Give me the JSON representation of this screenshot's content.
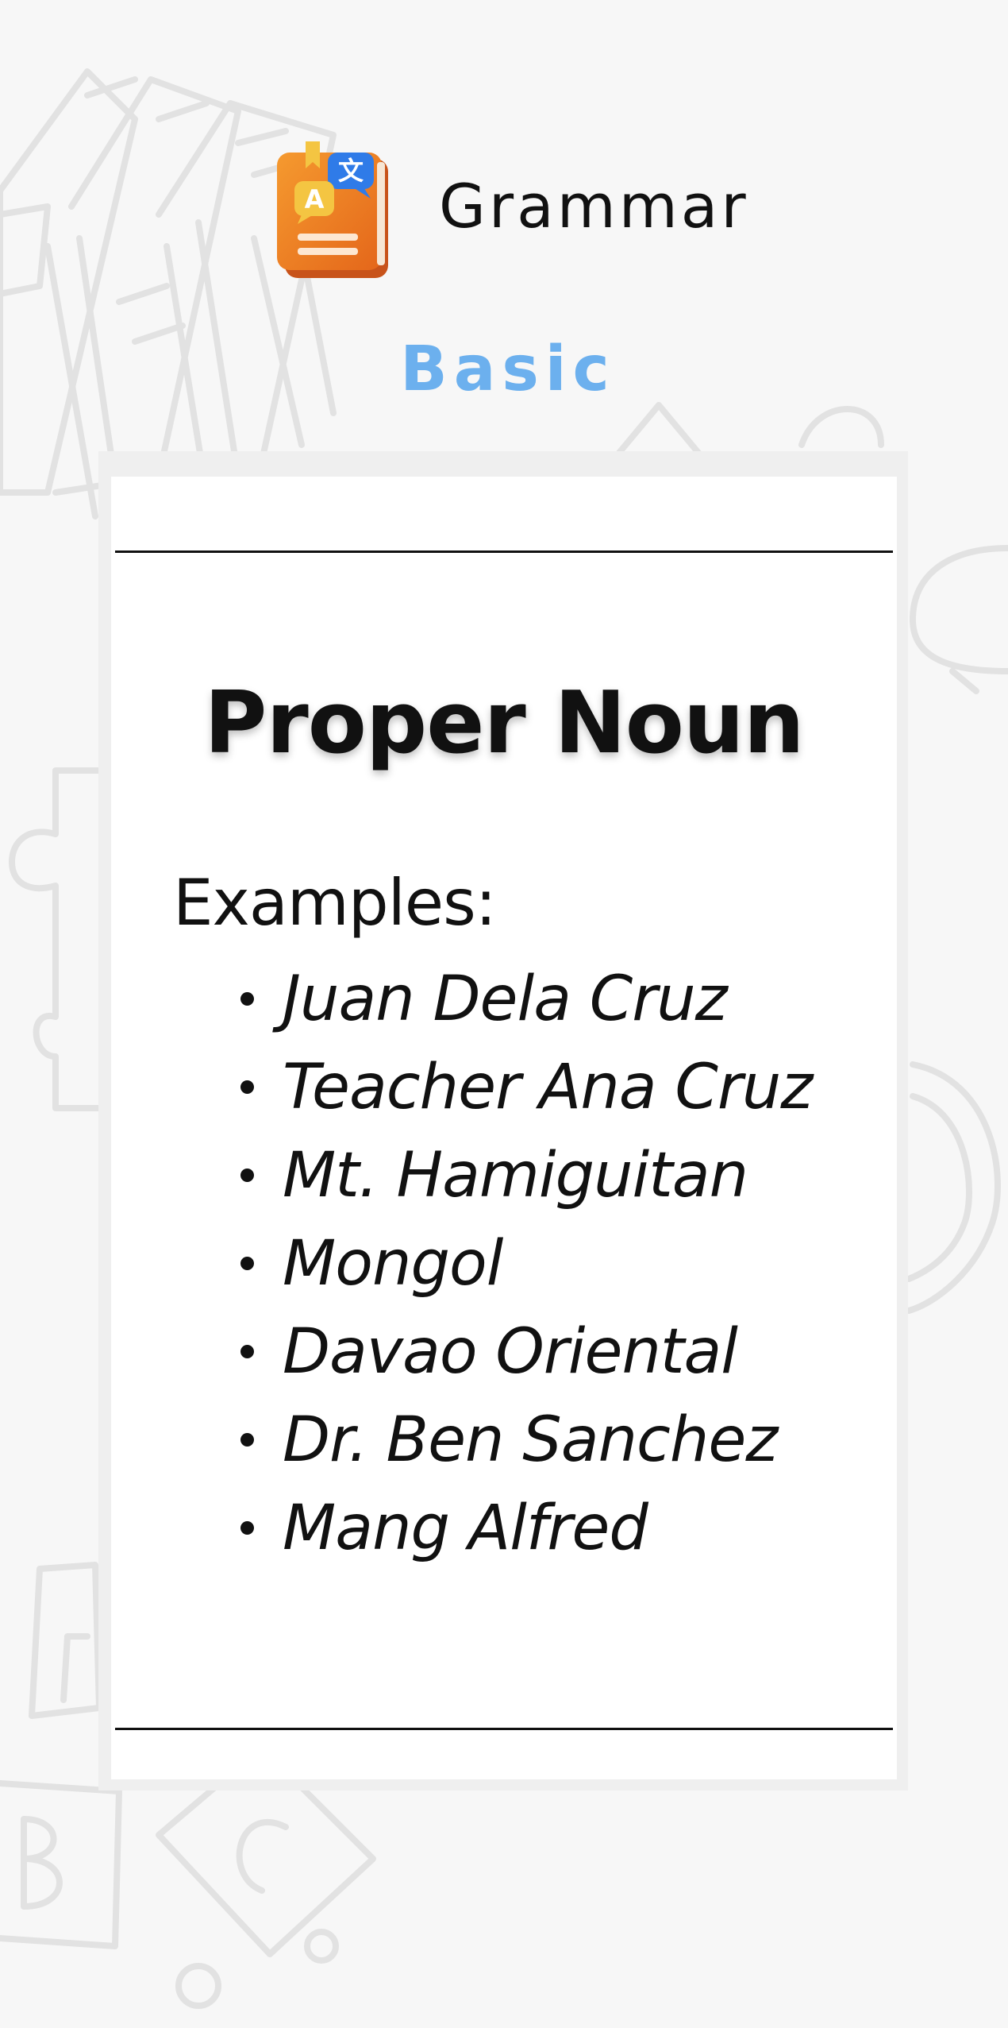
{
  "header": {
    "app_title": "Grammar",
    "icon": "grammar-book-translate-icon"
  },
  "level": "Basic",
  "card": {
    "title": "Proper Noun",
    "examples_label": "Examples:",
    "examples": [
      " Juan Dela Cruz",
      "Teacher Ana Cruz",
      "Mt. Hamiguitan",
      "Mongol",
      "Davao Oriental",
      "Dr. Ben Sanchez",
      "Mang Alfred"
    ]
  },
  "colors": {
    "background": "#f7f7f7",
    "card": "#ffffff",
    "level_accent": "#6cb0ee",
    "icon_book": "#ef7a1a",
    "icon_bubble_blue": "#2f7be8",
    "icon_bubble_yellow": "#f4c542",
    "text": "#111111"
  }
}
